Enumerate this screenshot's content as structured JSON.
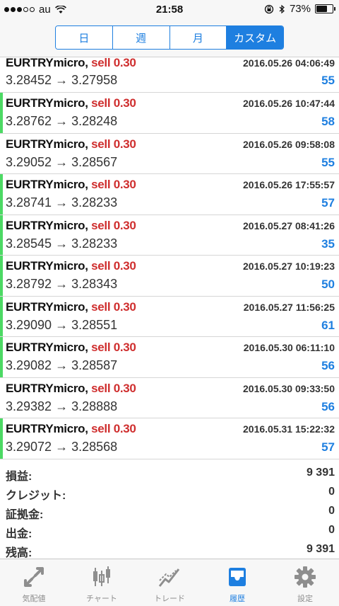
{
  "status_bar": {
    "carrier": "au",
    "time": "21:58",
    "battery": "73%"
  },
  "segments": [
    {
      "label": "日",
      "active": false
    },
    {
      "label": "週",
      "active": false
    },
    {
      "label": "月",
      "active": false
    },
    {
      "label": "カスタム",
      "active": true
    }
  ],
  "trades": [
    {
      "symbol": "EURTRYmicro,",
      "side": "sell 0.30",
      "time": "2016.05.26 04:06:49",
      "prices": "3.28452 → 3.27958",
      "profit": "55"
    },
    {
      "symbol": "EURTRYmicro,",
      "side": "sell 0.30",
      "time": "2016.05.26 10:47:44",
      "prices": "3.28762 → 3.28248",
      "profit": "58"
    },
    {
      "symbol": "EURTRYmicro,",
      "side": "sell 0.30",
      "time": "2016.05.26 09:58:08",
      "prices": "3.29052 → 3.28567",
      "profit": "55"
    },
    {
      "symbol": "EURTRYmicro,",
      "side": "sell 0.30",
      "time": "2016.05.26 17:55:57",
      "prices": "3.28741 → 3.28233",
      "profit": "57"
    },
    {
      "symbol": "EURTRYmicro,",
      "side": "sell 0.30",
      "time": "2016.05.27 08:41:26",
      "prices": "3.28545 → 3.28233",
      "profit": "35"
    },
    {
      "symbol": "EURTRYmicro,",
      "side": "sell 0.30",
      "time": "2016.05.27 10:19:23",
      "prices": "3.28792 → 3.28343",
      "profit": "50"
    },
    {
      "symbol": "EURTRYmicro,",
      "side": "sell 0.30",
      "time": "2016.05.27 11:56:25",
      "prices": "3.29090 → 3.28551",
      "profit": "61"
    },
    {
      "symbol": "EURTRYmicro,",
      "side": "sell 0.30",
      "time": "2016.05.30 06:11:10",
      "prices": "3.29082 → 3.28587",
      "profit": "56"
    },
    {
      "symbol": "EURTRYmicro,",
      "side": "sell 0.30",
      "time": "2016.05.30 09:33:50",
      "prices": "3.29382 → 3.28888",
      "profit": "56"
    },
    {
      "symbol": "EURTRYmicro,",
      "side": "sell 0.30",
      "time": "2016.05.31 15:22:32",
      "prices": "3.29072 → 3.28568",
      "profit": "57"
    }
  ],
  "summary": [
    {
      "label": "損益:",
      "value": "9 391"
    },
    {
      "label": "クレジット:",
      "value": "0"
    },
    {
      "label": "証拠金:",
      "value": "0"
    },
    {
      "label": "出金:",
      "value": "0"
    },
    {
      "label": "残高:",
      "value": "9 391"
    }
  ],
  "tabs": [
    {
      "label": "気配値",
      "icon": "quotes-arrows-icon",
      "active": false
    },
    {
      "label": "チャート",
      "icon": "candlestick-chart-icon",
      "active": false
    },
    {
      "label": "トレード",
      "icon": "trade-line-icon",
      "active": false
    },
    {
      "label": "履歴",
      "icon": "history-tray-icon",
      "active": true
    },
    {
      "label": "設定",
      "icon": "gear-icon",
      "active": false
    }
  ],
  "colors": {
    "accent": "#1e7fe0",
    "sell": "#cf2e2e",
    "profit_bar": "#4cd964"
  }
}
